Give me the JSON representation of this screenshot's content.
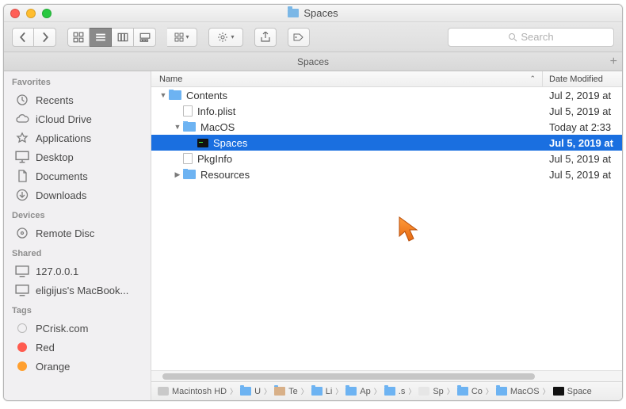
{
  "window": {
    "title": "Spaces"
  },
  "toolbar": {
    "search_placeholder": "Search"
  },
  "tabbar": {
    "label": "Spaces"
  },
  "sidebar": {
    "sections": [
      {
        "title": "Favorites",
        "items": [
          {
            "label": "Recents",
            "icon": "clock-icon"
          },
          {
            "label": "iCloud Drive",
            "icon": "cloud-icon"
          },
          {
            "label": "Applications",
            "icon": "apps-icon"
          },
          {
            "label": "Desktop",
            "icon": "desktop-icon"
          },
          {
            "label": "Documents",
            "icon": "documents-icon"
          },
          {
            "label": "Downloads",
            "icon": "downloads-icon"
          }
        ]
      },
      {
        "title": "Devices",
        "items": [
          {
            "label": "Remote Disc",
            "icon": "disc-icon"
          }
        ]
      },
      {
        "title": "Shared",
        "items": [
          {
            "label": "127.0.0.1",
            "icon": "monitor-icon"
          },
          {
            "label": "eligijus's MacBook...",
            "icon": "monitor-icon"
          }
        ]
      },
      {
        "title": "Tags",
        "items": [
          {
            "label": "PCrisk.com",
            "icon": "tag-icon",
            "color": ""
          },
          {
            "label": "Red",
            "icon": "tag-icon",
            "color": "#ff5b4f"
          },
          {
            "label": "Orange",
            "icon": "tag-icon",
            "color": "#ff9f2e"
          }
        ]
      }
    ]
  },
  "columns": {
    "name": "Name",
    "date": "Date Modified"
  },
  "files": [
    {
      "indent": 0,
      "expand": "down",
      "type": "folder",
      "name": "Contents",
      "date": "Jul 2, 2019 at",
      "selected": false
    },
    {
      "indent": 1,
      "expand": "",
      "type": "file",
      "name": "Info.plist",
      "date": "Jul 5, 2019 at",
      "selected": false
    },
    {
      "indent": 1,
      "expand": "down",
      "type": "folder",
      "name": "MacOS",
      "date": "Today at 2:33",
      "selected": false
    },
    {
      "indent": 2,
      "expand": "",
      "type": "exec",
      "name": "Spaces",
      "date": "Jul 5, 2019 at ",
      "selected": true
    },
    {
      "indent": 1,
      "expand": "",
      "type": "file",
      "name": "PkgInfo",
      "date": "Jul 5, 2019 at",
      "selected": false
    },
    {
      "indent": 1,
      "expand": "right",
      "type": "folder",
      "name": "Resources",
      "date": "Jul 5, 2019 at",
      "selected": false
    }
  ],
  "pathbar": [
    {
      "icon": "hd",
      "label": "Macintosh HD"
    },
    {
      "icon": "folder",
      "label": "U"
    },
    {
      "icon": "home",
      "label": "Te"
    },
    {
      "icon": "folder",
      "label": "Li"
    },
    {
      "icon": "folder",
      "label": "Ap"
    },
    {
      "icon": "folder",
      "label": ".s"
    },
    {
      "icon": "app",
      "label": "Sp"
    },
    {
      "icon": "folder",
      "label": "Co"
    },
    {
      "icon": "folder",
      "label": "MacOS"
    },
    {
      "icon": "exec",
      "label": "Space"
    }
  ]
}
